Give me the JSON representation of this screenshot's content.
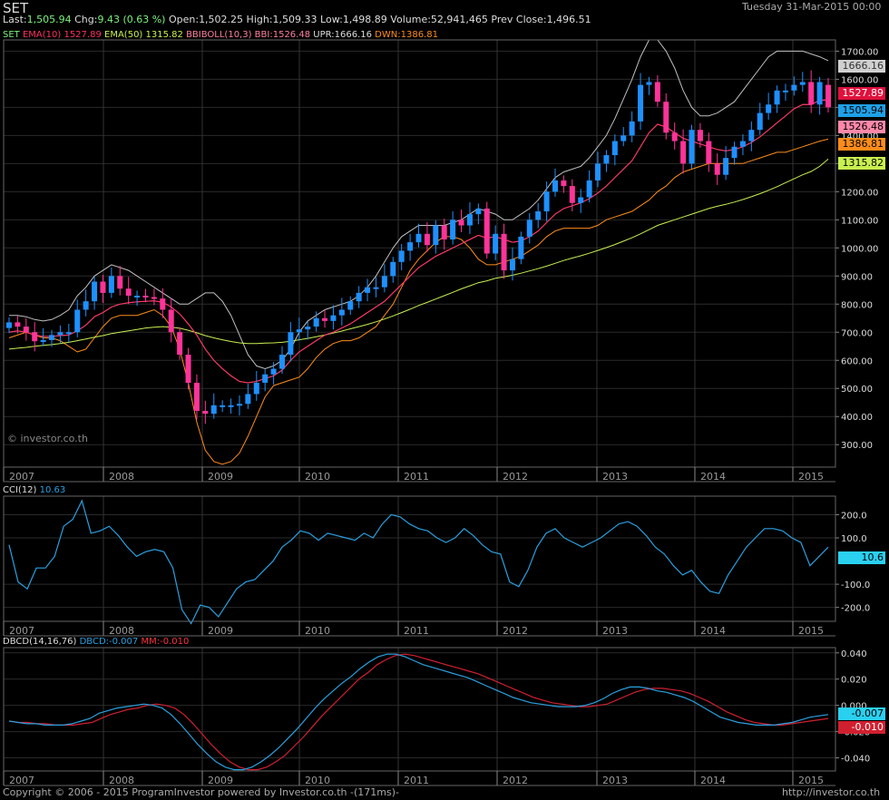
{
  "header": {
    "symbol": "SET",
    "datetime": "Tuesday 31-Mar-2015 00:00",
    "last_label": "Last:",
    "last": "1,505.94",
    "chg_label": "Chg:",
    "chg": "9.43 (0.63 %)",
    "open_label": "Open:",
    "open": "1,502.25",
    "high_label": "High:",
    "high": "1,509.33",
    "low_label": "Low:",
    "low": "1,498.89",
    "volume_label": "Volume:",
    "volume": "52,941,465",
    "prev_label": "Prev Close:",
    "prev": "1,496.51"
  },
  "legend": {
    "symbol": "SET",
    "ema10": "EMA(10) 1527.89",
    "ema50": "EMA(50) 1315.82",
    "bbi": "BBIBOLL(10,3) BBI:1526.48",
    "upr": "UPR:1666.16",
    "dwn": "DWN:1386.81"
  },
  "price_tags": {
    "upr": "1666.16",
    "ema10": "1527.89",
    "last": "1505.94",
    "bbi": "1526.48",
    "dwn": "1386.81",
    "ema50": "1315.82"
  },
  "cci": {
    "title": "CCI(12)",
    "value": "10.63",
    "tag": "10.6"
  },
  "dbcd": {
    "title": "DBCD(14,16,76)",
    "dbcd_value": "DBCD:-0.007",
    "mm_value": "MM:-0.010",
    "tag_dbcd": "-0.007",
    "tag_mm": "-0.010"
  },
  "footer": {
    "copyright": "Copyright © 2006 - 2015 ProgramInvestor powered by Investor.co.th -(171ms)-",
    "url": "http://investor.co.th"
  },
  "watermark": "© investor.co.th",
  "colors": {
    "up": "#1e90ff",
    "down": "#ff3399",
    "ema10": "#ff3060",
    "ema50": "#c8f050",
    "upr": "#c0c0c0",
    "dwn": "#ff8c1a",
    "bbi": "#ff80a0",
    "cci": "#2aa0e0",
    "dbcd": "#2aa0e0",
    "mm": "#d02030"
  },
  "chart_data": [
    {
      "type": "candlestick",
      "title": "SET",
      "x_labels": [
        "2007",
        "2008",
        "2009",
        "2010",
        "2011",
        "2012",
        "2013",
        "2014",
        "2015"
      ],
      "y_ticks": [
        300,
        400,
        500,
        600,
        700,
        800,
        900,
        1000,
        1100,
        1200,
        1300,
        1400,
        1500,
        1600,
        1700
      ],
      "ylim": [
        220,
        1740
      ],
      "series": [
        {
          "name": "EMA(10)",
          "last": 1527.89
        },
        {
          "name": "EMA(50)",
          "last": 1315.82
        },
        {
          "name": "BBI",
          "last": 1526.48
        },
        {
          "name": "UPR",
          "last": 1666.16
        },
        {
          "name": "DWN",
          "last": 1386.81
        }
      ],
      "close": [
        735,
        720,
        700,
        668,
        672,
        690,
        700,
        700,
        780,
        810,
        880,
        840,
        900,
        855,
        830,
        830,
        825,
        820,
        780,
        700,
        620,
        520,
        420,
        410,
        440,
        440,
        440,
        445,
        480,
        520,
        550,
        570,
        620,
        700,
        710,
        720,
        750,
        740,
        760,
        780,
        810,
        840,
        860,
        860,
        900,
        950,
        990,
        1020,
        1050,
        1010,
        1080,
        1030,
        1100,
        1080,
        1120,
        1140,
        980,
        1050,
        920,
        960,
        1040,
        1100,
        1130,
        1200,
        1240,
        1220,
        1160,
        1180,
        1240,
        1300,
        1330,
        1380,
        1400,
        1450,
        1580,
        1590,
        1520,
        1410,
        1380,
        1300,
        1420,
        1380,
        1300,
        1260,
        1320,
        1360,
        1380,
        1420,
        1480,
        1510,
        1560,
        1560,
        1580,
        1590,
        1510,
        1590,
        1500
      ],
      "open": [
        715,
        735,
        720,
        700,
        668,
        672,
        690,
        700,
        700,
        780,
        810,
        880,
        840,
        900,
        855,
        830,
        830,
        825,
        820,
        780,
        700,
        620,
        520,
        420,
        410,
        440,
        440,
        440,
        445,
        480,
        520,
        550,
        570,
        620,
        700,
        710,
        720,
        750,
        740,
        760,
        780,
        810,
        840,
        860,
        860,
        900,
        950,
        990,
        1020,
        1050,
        1010,
        1080,
        1030,
        1100,
        1080,
        1120,
        1140,
        980,
        1050,
        920,
        960,
        1040,
        1100,
        1130,
        1200,
        1240,
        1220,
        1160,
        1180,
        1240,
        1300,
        1330,
        1380,
        1400,
        1450,
        1580,
        1590,
        1520,
        1410,
        1380,
        1300,
        1420,
        1380,
        1300,
        1260,
        1320,
        1360,
        1380,
        1420,
        1480,
        1510,
        1560,
        1560,
        1580,
        1590,
        1510,
        1580
      ],
      "ema10": [
        700,
        705,
        700,
        690,
        685,
        685,
        688,
        690,
        705,
        725,
        755,
        770,
        790,
        800,
        805,
        808,
        810,
        812,
        806,
        790,
        765,
        730,
        690,
        640,
        600,
        570,
        545,
        525,
        520,
        525,
        535,
        545,
        565,
        600,
        630,
        650,
        670,
        690,
        700,
        715,
        730,
        750,
        770,
        790,
        810,
        840,
        870,
        900,
        930,
        950,
        970,
        985,
        1000,
        1015,
        1030,
        1045,
        1035,
        1040,
        1030,
        1020,
        1025,
        1040,
        1060,
        1090,
        1120,
        1140,
        1150,
        1160,
        1175,
        1195,
        1220,
        1250,
        1280,
        1310,
        1360,
        1410,
        1440,
        1430,
        1410,
        1390,
        1380,
        1370,
        1360,
        1350,
        1345,
        1350,
        1360,
        1375,
        1395,
        1420,
        1445,
        1470,
        1495,
        1510,
        1510,
        1525,
        1528
      ],
      "ema50": [
        640,
        643,
        646,
        650,
        653,
        656,
        660,
        664,
        670,
        676,
        682,
        688,
        695,
        700,
        705,
        710,
        715,
        718,
        720,
        718,
        714,
        707,
        698,
        688,
        680,
        673,
        667,
        662,
        660,
        660,
        661,
        662,
        664,
        668,
        673,
        678,
        684,
        690,
        697,
        704,
        712,
        720,
        728,
        737,
        747,
        758,
        770,
        782,
        795,
        806,
        818,
        830,
        842,
        854,
        865,
        876,
        883,
        892,
        897,
        903,
        910,
        918,
        926,
        935,
        945,
        955,
        964,
        972,
        981,
        991,
        1001,
        1012,
        1024,
        1036,
        1050,
        1065,
        1080,
        1090,
        1100,
        1110,
        1120,
        1130,
        1140,
        1148,
        1155,
        1163,
        1172,
        1182,
        1193,
        1205,
        1218,
        1232,
        1246,
        1260,
        1272,
        1290,
        1316
      ],
      "upr": [
        760,
        760,
        755,
        745,
        740,
        745,
        760,
        780,
        830,
        860,
        900,
        920,
        940,
        930,
        920,
        900,
        880,
        860,
        840,
        820,
        800,
        800,
        820,
        840,
        840,
        810,
        760,
        690,
        620,
        580,
        570,
        580,
        600,
        640,
        700,
        740,
        760,
        780,
        790,
        800,
        810,
        830,
        860,
        900,
        950,
        1000,
        1040,
        1060,
        1080,
        1080,
        1080,
        1080,
        1090,
        1100,
        1120,
        1140,
        1130,
        1120,
        1100,
        1100,
        1120,
        1140,
        1170,
        1210,
        1250,
        1270,
        1280,
        1290,
        1320,
        1360,
        1400,
        1460,
        1530,
        1600,
        1680,
        1740,
        1740,
        1700,
        1640,
        1560,
        1500,
        1470,
        1470,
        1480,
        1500,
        1520,
        1560,
        1600,
        1640,
        1680,
        1700,
        1700,
        1700,
        1700,
        1690,
        1680,
        1666
      ],
      "dwn": [
        680,
        690,
        700,
        690,
        680,
        680,
        670,
        650,
        630,
        640,
        680,
        720,
        750,
        760,
        760,
        760,
        770,
        780,
        760,
        720,
        640,
        520,
        380,
        280,
        240,
        230,
        240,
        270,
        330,
        400,
        470,
        510,
        520,
        530,
        540,
        570,
        610,
        640,
        660,
        670,
        670,
        680,
        700,
        720,
        760,
        800,
        860,
        920,
        960,
        990,
        1020,
        1040,
        1040,
        1030,
        1000,
        960,
        940,
        940,
        950,
        960,
        970,
        990,
        1010,
        1040,
        1060,
        1070,
        1070,
        1070,
        1070,
        1080,
        1100,
        1110,
        1120,
        1130,
        1150,
        1170,
        1200,
        1220,
        1250,
        1270,
        1280,
        1290,
        1300,
        1300,
        1300,
        1300,
        1300,
        1310,
        1320,
        1330,
        1340,
        1340,
        1350,
        1360,
        1370,
        1380,
        1387
      ],
      "bbi": [
        700,
        705,
        700,
        690,
        685,
        685,
        688,
        690,
        705,
        725,
        755,
        770,
        790,
        800,
        805,
        808,
        810,
        812,
        806,
        790,
        765,
        730,
        690,
        640,
        600,
        570,
        545,
        525,
        520,
        525,
        535,
        545,
        565,
        600,
        630,
        650,
        670,
        690,
        700,
        715,
        730,
        750,
        770,
        790,
        810,
        840,
        870,
        900,
        930,
        950,
        970,
        985,
        1000,
        1015,
        1030,
        1045,
        1035,
        1040,
        1030,
        1020,
        1025,
        1040,
        1060,
        1090,
        1120,
        1140,
        1150,
        1160,
        1175,
        1195,
        1220,
        1250,
        1280,
        1310,
        1360,
        1410,
        1440,
        1430,
        1410,
        1390,
        1380,
        1370,
        1360,
        1350,
        1345,
        1350,
        1360,
        1375,
        1395,
        1420,
        1445,
        1470,
        1495,
        1510,
        1510,
        1525,
        1526
      ]
    },
    {
      "type": "line",
      "title": "CCI(12)",
      "x_labels": [
        "2007",
        "2008",
        "2009",
        "2010",
        "2011",
        "2012",
        "2013",
        "2014",
        "2015"
      ],
      "y_ticks": [
        200,
        100,
        -100,
        -200
      ],
      "ylim": [
        -260,
        280
      ],
      "series": [
        {
          "name": "CCI(12)",
          "values": [
            70,
            -90,
            -120,
            -30,
            -30,
            20,
            150,
            180,
            260,
            120,
            130,
            150,
            110,
            60,
            20,
            40,
            50,
            40,
            -30,
            -210,
            -270,
            -190,
            -200,
            -240,
            -180,
            -120,
            -90,
            -80,
            -40,
            0,
            60,
            90,
            130,
            120,
            90,
            120,
            110,
            100,
            90,
            120,
            100,
            160,
            200,
            190,
            160,
            140,
            130,
            100,
            80,
            100,
            140,
            110,
            70,
            40,
            30,
            -90,
            -110,
            -40,
            60,
            120,
            140,
            100,
            80,
            60,
            80,
            100,
            130,
            160,
            170,
            150,
            110,
            60,
            30,
            -20,
            -60,
            -40,
            -90,
            -130,
            -140,
            -60,
            0,
            60,
            100,
            140,
            140,
            130,
            100,
            80,
            -20,
            20,
            60
          ]
        }
      ]
    },
    {
      "type": "line",
      "title": "DBCD(14,16,76)",
      "x_labels": [
        "2007",
        "2008",
        "2009",
        "2010",
        "2011",
        "2012",
        "2013",
        "2014",
        "2015"
      ],
      "y_ticks": [
        0.04,
        0.02,
        0.0,
        -0.02,
        -0.04
      ],
      "ylim": [
        -0.05,
        0.044
      ],
      "series": [
        {
          "name": "DBCD",
          "values": [
            -0.012,
            -0.013,
            -0.014,
            -0.014,
            -0.015,
            -0.015,
            -0.015,
            -0.014,
            -0.012,
            -0.01,
            -0.006,
            -0.004,
            -0.002,
            -0.001,
            0.0,
            0.001,
            0.0,
            -0.002,
            -0.007,
            -0.014,
            -0.022,
            -0.03,
            -0.037,
            -0.043,
            -0.047,
            -0.049,
            -0.049,
            -0.047,
            -0.043,
            -0.038,
            -0.032,
            -0.025,
            -0.018,
            -0.01,
            -0.002,
            0.005,
            0.011,
            0.017,
            0.022,
            0.028,
            0.033,
            0.037,
            0.039,
            0.039,
            0.037,
            0.034,
            0.031,
            0.029,
            0.027,
            0.025,
            0.023,
            0.021,
            0.018,
            0.015,
            0.012,
            0.009,
            0.006,
            0.004,
            0.002,
            0.001,
            0.0,
            -0.001,
            -0.001,
            -0.001,
            0.0,
            0.002,
            0.005,
            0.009,
            0.012,
            0.014,
            0.014,
            0.013,
            0.011,
            0.01,
            0.008,
            0.006,
            0.003,
            -0.001,
            -0.005,
            -0.009,
            -0.011,
            -0.013,
            -0.014,
            -0.015,
            -0.015,
            -0.015,
            -0.014,
            -0.013,
            -0.011,
            -0.009,
            -0.008,
            -0.007
          ]
        },
        {
          "name": "MM",
          "values": [
            -0.012,
            -0.013,
            -0.013,
            -0.014,
            -0.014,
            -0.015,
            -0.015,
            -0.015,
            -0.014,
            -0.013,
            -0.01,
            -0.007,
            -0.005,
            -0.003,
            -0.002,
            0.0,
            0.001,
            0.0,
            -0.002,
            -0.007,
            -0.014,
            -0.022,
            -0.03,
            -0.037,
            -0.043,
            -0.047,
            -0.049,
            -0.049,
            -0.047,
            -0.043,
            -0.038,
            -0.031,
            -0.024,
            -0.016,
            -0.008,
            -0.001,
            0.006,
            0.013,
            0.02,
            0.025,
            0.031,
            0.035,
            0.038,
            0.039,
            0.038,
            0.036,
            0.034,
            0.032,
            0.03,
            0.028,
            0.026,
            0.024,
            0.021,
            0.018,
            0.015,
            0.012,
            0.009,
            0.006,
            0.004,
            0.002,
            0.001,
            0.0,
            -0.001,
            -0.001,
            0.0,
            0.001,
            0.004,
            0.007,
            0.01,
            0.012,
            0.013,
            0.013,
            0.012,
            0.011,
            0.009,
            0.006,
            0.003,
            -0.001,
            -0.005,
            -0.008,
            -0.011,
            -0.013,
            -0.014,
            -0.015,
            -0.015,
            -0.014,
            -0.013,
            -0.012,
            -0.011,
            -0.01
          ]
        }
      ]
    }
  ]
}
